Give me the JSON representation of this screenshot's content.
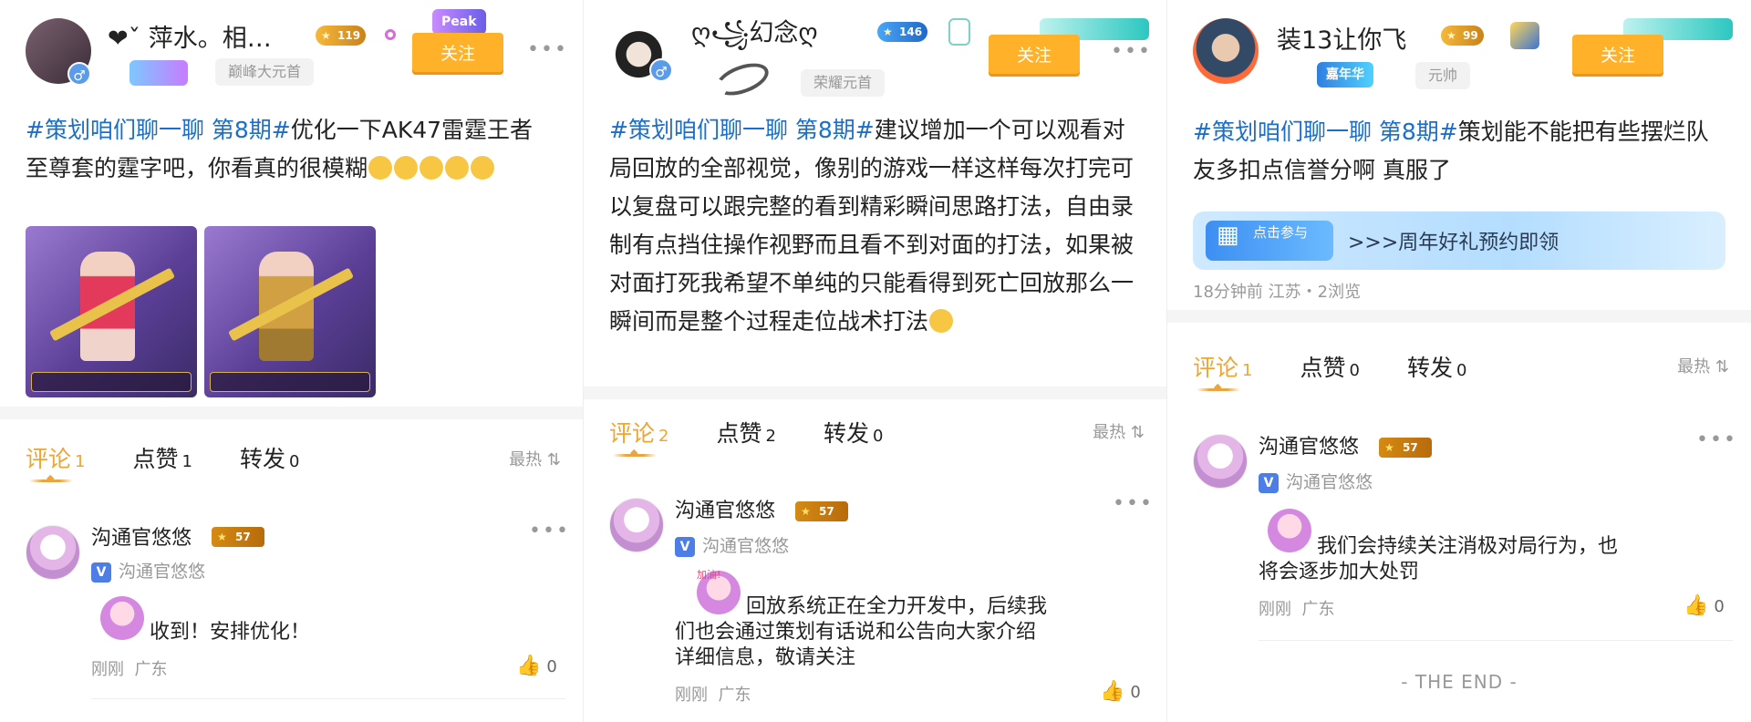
{
  "panels": [
    {
      "user": {
        "name": "❤ˇ 萍水。相…",
        "level": "119",
        "title_tag": "巅峰大元首",
        "badge": "Peak",
        "follow": "关注"
      },
      "post": {
        "topic": "#策划咱们聊一聊 第8期#",
        "text": "优化一下AK47雷霆王者至尊套的霆字吧，你看真的很模糊",
        "emoji_count": 5
      },
      "images": 2,
      "tabs": {
        "comment": {
          "label": "评论",
          "count": "1"
        },
        "like": {
          "label": "点赞",
          "count": "1"
        },
        "share": {
          "label": "转发",
          "count": "0"
        },
        "sort": "最热"
      },
      "comment": {
        "author": "沟通官悠悠",
        "level": "57",
        "sub": "沟通官悠悠",
        "text": "收到！安排优化！",
        "time": "刚刚",
        "region": "广东",
        "likes": "0"
      }
    },
    {
      "user": {
        "name": "ღ꧁幻念ღ",
        "level": "146",
        "title_tag": "荣耀元首",
        "follow": "关注"
      },
      "post": {
        "topic": "#策划咱们聊一聊 第8期#",
        "text": "建议增加一个可以观看对局回放的全部视觉，像别的游戏一样这样每次打完可以复盘可以跟完整的看到精彩瞬间思路打法，自由录制有点挡住操作视野而且看不到对面的打法，如果被对面打死我希望不单纯的只能看得到死亡回放那么一瞬间而是整个过程走位战术打法"
      },
      "tabs": {
        "comment": {
          "label": "评论",
          "count": "2"
        },
        "like": {
          "label": "点赞",
          "count": "2"
        },
        "share": {
          "label": "转发",
          "count": "0"
        },
        "sort": "最热"
      },
      "comment": {
        "author": "沟通官悠悠",
        "level": "57",
        "sub": "沟通官悠悠",
        "sticker_label": "加油!",
        "text_line1": "回放系统正在全力开发中，后续我",
        "text_line2": "们也会通过策划有话说和公告向大家介绍",
        "text_line3": "详细信息，敬请关注",
        "time": "刚刚",
        "region": "广东",
        "likes": "0"
      }
    },
    {
      "user": {
        "name": "装13让你飞",
        "level": "99",
        "title_tag": "元帅",
        "badge": "嘉年华",
        "follow": "关注"
      },
      "post": {
        "topic": "#策划咱们聊一聊 第8期#",
        "text": "策划能不能把有些摆烂队友多扣点信誉分啊 真服了"
      },
      "banner": {
        "button": "点击参与",
        "text": ">>>周年好礼预约即领"
      },
      "meta": "18分钟前 江苏・2浏览",
      "tabs": {
        "comment": {
          "label": "评论",
          "count": "1"
        },
        "like": {
          "label": "点赞",
          "count": "0"
        },
        "share": {
          "label": "转发",
          "count": "0"
        },
        "sort": "最热"
      },
      "comment": {
        "author": "沟通官悠悠",
        "level": "57",
        "sub": "沟通官悠悠",
        "text_line1": "我们会持续关注消极对局行为，也",
        "text_line2": "将会逐步加大处罚",
        "time": "刚刚",
        "region": "广东",
        "likes": "0"
      },
      "end": "- THE END -"
    }
  ],
  "colors": {
    "accent": "#ffb12a",
    "topic": "#1c6fc9",
    "tab_active": "#f0a531"
  },
  "icons": [
    "gender-male-icon",
    "more-dots-icon",
    "thumb-up-icon",
    "sort-icon",
    "verified-v-icon",
    "crying-emoji-icon",
    "smile-emoji-icon"
  ]
}
